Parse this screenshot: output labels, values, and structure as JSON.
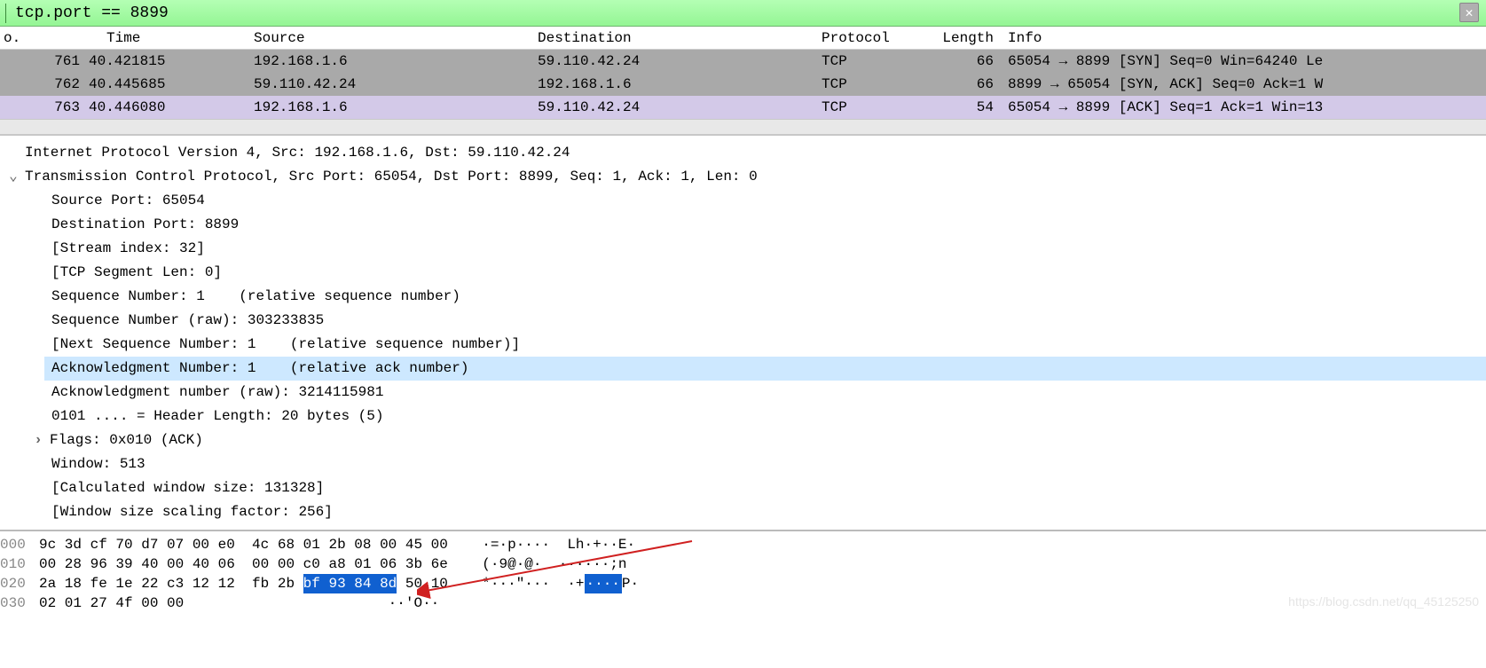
{
  "filter": {
    "text": "tcp.port == 8899"
  },
  "columns": {
    "no": "o.",
    "time": "Time",
    "source": "Source",
    "destination": "Destination",
    "protocol": "Protocol",
    "length": "Length",
    "info": "Info"
  },
  "packets": [
    {
      "no": "761",
      "time": "40.421815",
      "src": "192.168.1.6",
      "dst": "59.110.42.24",
      "proto": "TCP",
      "len": "66",
      "info": "65054 → 8899 [SYN] Seq=0 Win=64240 Le"
    },
    {
      "no": "762",
      "time": "40.445685",
      "src": "59.110.42.24",
      "dst": "192.168.1.6",
      "proto": "TCP",
      "len": "66",
      "info": "8899 → 65054 [SYN, ACK] Seq=0 Ack=1 W"
    },
    {
      "no": "763",
      "time": "40.446080",
      "src": "192.168.1.6",
      "dst": "59.110.42.24",
      "proto": "TCP",
      "len": "54",
      "info": "65054 → 8899 [ACK] Seq=1 Ack=1 Win=13"
    }
  ],
  "details": {
    "ipv4": "Internet Protocol Version 4, Src: 192.168.1.6, Dst: 59.110.42.24",
    "tcp_header": "Transmission Control Protocol, Src Port: 65054, Dst Port: 8899, Seq: 1, Ack: 1, Len: 0",
    "fields": [
      "Source Port: 65054",
      "Destination Port: 8899",
      "[Stream index: 32]",
      "[TCP Segment Len: 0]",
      "Sequence Number: 1    (relative sequence number)",
      "Sequence Number (raw): 303233835",
      "[Next Sequence Number: 1    (relative sequence number)]"
    ],
    "ack_highlight": "Acknowledgment Number: 1    (relative ack number)",
    "fields2": [
      "Acknowledgment number (raw): 3214115981",
      "0101 .... = Header Length: 20 bytes (5)"
    ],
    "flags": "Flags: 0x010 (ACK)",
    "fields3": [
      "Window: 513",
      "[Calculated window size: 131328]",
      "[Window size scaling factor: 256]"
    ]
  },
  "hex": {
    "rows": [
      {
        "off": "000",
        "b1": "9c 3d cf 70 d7 07 00 e0",
        "b2": "  4c 68 01 2b 08 00 45 00",
        "ascii": "    ·=·p····  Lh·+··E·"
      },
      {
        "off": "010",
        "b1": "00 28 96 39 40 00 40 06",
        "b2": "  00 00 c0 a8 01 06 3b 6e",
        "ascii": "    (·9@·@·  ······;n"
      },
      {
        "off": "020",
        "b1": "2a 18 fe 1e 22 c3 12 12",
        "b2a": "  fb 2b ",
        "sel": "bf 93 84 8d",
        "b2b": " 50 10",
        "ascii_a": "    *···\"···  ·+",
        "ascii_sel": "····",
        "ascii_b": "P·"
      },
      {
        "off": "030",
        "b1": "02 01 27 4f 00 00",
        "b2": "",
        "ascii": "                        ··'O··"
      }
    ]
  },
  "watermark": "https://blog.csdn.net/qq_45125250"
}
